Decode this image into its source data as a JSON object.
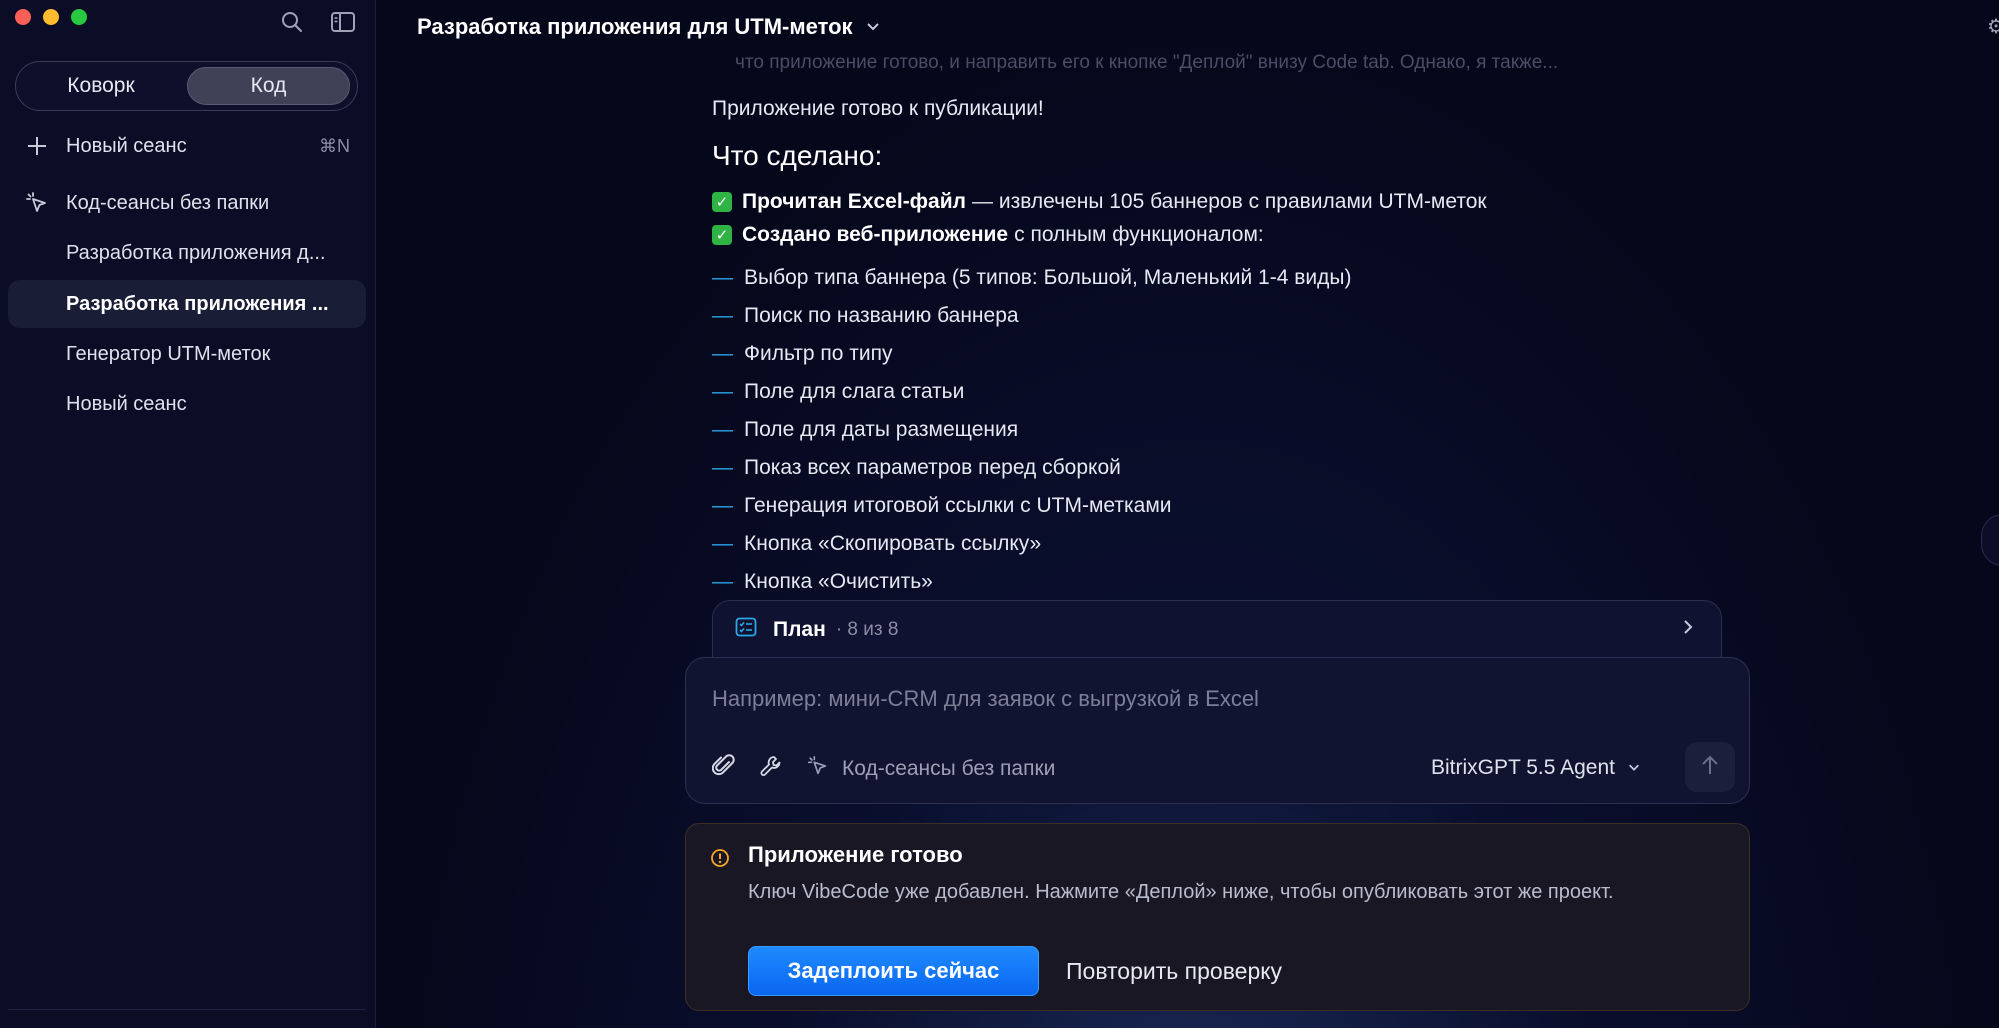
{
  "sidebar": {
    "modes": {
      "coworking": "Коворк",
      "code": "Код"
    },
    "new_session": {
      "label": "Новый сеанс",
      "shortcut": "⌘N"
    },
    "folder": {
      "label": "Код-сеансы без папки"
    },
    "sessions": [
      {
        "label": "Разработка приложения д..."
      },
      {
        "label": "Разработка приложения ..."
      },
      {
        "label": "Генератор UTM-меток"
      },
      {
        "label": "Новый сеанс"
      }
    ]
  },
  "header": {
    "title": "Разработка приложения для UTM-меток"
  },
  "chat": {
    "faded_line": "что приложение готово, и направить его к кнопке \"Деплой\" внизу Code tab. Однако, я также...",
    "ready": "Приложение готово к публикации!",
    "done_title": "Что сделано:",
    "checks": [
      {
        "bold": "Прочитан Excel-файл",
        "rest": " — извлечены 105 баннеров с правилами UTM-меток"
      },
      {
        "bold": "Создано веб-приложение",
        "rest": " с полным функционалом:"
      }
    ],
    "features": [
      "Выбор типа баннера (5 типов: Большой, Маленький 1-4 виды)",
      "Поиск по названию баннера",
      "Фильтр по типу",
      "Поле для слага статьи",
      "Поле для даты размещения",
      "Показ всех параметров перед сборкой",
      "Генерация итоговой ссылки с UTM-метками",
      "Кнопка «Скопировать ссылку»",
      "Кнопка «Очистить»"
    ]
  },
  "plan": {
    "label": "План",
    "count": "· 8 из 8"
  },
  "composer": {
    "placeholder": "Например: мини-CRM для заявок с выгрузкой в Excel",
    "folder": "Код-сеансы без папки",
    "model": "BitrixGPT 5.5 Agent"
  },
  "notice": {
    "title": "Приложение готово",
    "text": "Ключ VibeCode уже добавлен. Нажмите «Деплой» ниже, чтобы опубликовать этот же проект.",
    "deploy": "Задеплоить сейчас",
    "retry": "Повторить проверку"
  },
  "colors": {
    "accent": "#2aa7e8",
    "deploy": "#0a66f0",
    "warning": "#f5a623",
    "check": "#2fb344"
  }
}
